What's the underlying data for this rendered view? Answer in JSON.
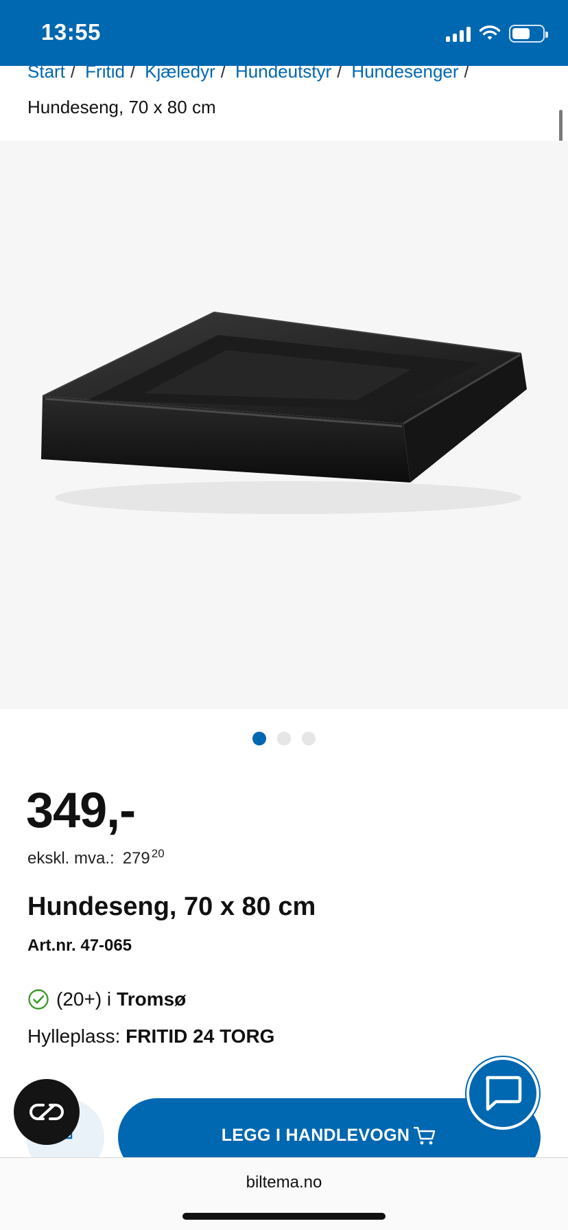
{
  "status_bar": {
    "time": "13:55"
  },
  "breadcrumb": {
    "links": [
      "Start",
      "Fritid",
      "Kjæledyr",
      "Hundeutstyr",
      "Hundesenger"
    ],
    "separator": "/",
    "current": "Hundeseng, 70 x 80 cm"
  },
  "gallery": {
    "image_count": 3,
    "active_index": 0,
    "product_color": "#1a1a1a"
  },
  "product": {
    "price": "349,-",
    "vat_label": "ekskl. mva.:",
    "vat_value": "279",
    "vat_decimals": "20",
    "title": "Hundeseng, 70 x 80 cm",
    "artnr": "Art.nr. 47-065"
  },
  "stock": {
    "icon": "check-circle-icon",
    "count": "(20+) i",
    "store": "Tromsø",
    "shelf_label": "Hylleplass:",
    "shelf_value": "FRITID 24 TORG"
  },
  "actions": {
    "add_to_cart_label": "LEGG I HANDLEVOGN"
  },
  "browser": {
    "url": "biltema.no"
  },
  "colors": {
    "brand_blue": "#0067b1",
    "stock_green": "#3c9a2a"
  }
}
